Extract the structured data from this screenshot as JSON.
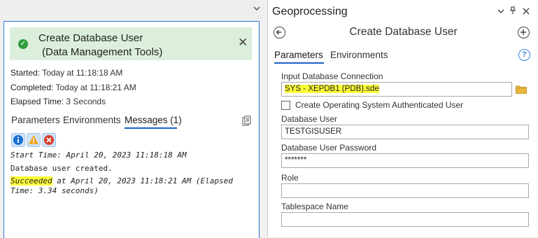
{
  "left": {
    "banner_title": "Create Database User",
    "banner_subtitle": "(Data Management Tools)",
    "started_label": "Started:",
    "started_value": "Today at 11:18:18 AM",
    "completed_label": "Completed:",
    "completed_value": "Today at 11:18:21 AM",
    "elapsed_label": "Elapsed Time:",
    "elapsed_value": "3 Seconds",
    "tabs": [
      "Parameters",
      "Environments",
      "Messages (1)"
    ],
    "messages": {
      "line1": "Start Time: April 20, 2023 11:18:18 AM",
      "line2": "Database user created.",
      "line3_highlight": "Succeeded",
      "line3_rest": " at April 20, 2023 11:18:21 AM (Elapsed",
      "line4": "Time: 3.34 seconds)"
    }
  },
  "right": {
    "pane_title": "Geoprocessing",
    "tool_title": "Create Database User",
    "tabs": [
      "Parameters",
      "Environments"
    ],
    "fields": {
      "connection_label": "Input Database Connection",
      "connection_value": "SYS - XEPDB1 (PDB).sde",
      "os_auth_label": "Create Operating System Authenticated User",
      "user_label": "Database User",
      "user_value": "TESTGISUSER",
      "password_label": "Database User Password",
      "password_value": "*******",
      "role_label": "Role",
      "role_value": "",
      "tablespace_label": "Tablespace Name",
      "tablespace_value": ""
    }
  },
  "colors": {
    "accent": "#1a62c4",
    "success_bg": "#dcefdc",
    "success_icon": "#2e9e3e",
    "highlight": "#ffff38"
  },
  "icons": {
    "success": "check-circle-icon",
    "close": "close-icon",
    "copy": "copy-icon",
    "info": "info-icon",
    "warning": "warning-icon",
    "error": "error-icon",
    "back": "back-arrow-icon",
    "add": "plus-circle-icon",
    "help": "help-icon",
    "folder": "folder-icon"
  }
}
